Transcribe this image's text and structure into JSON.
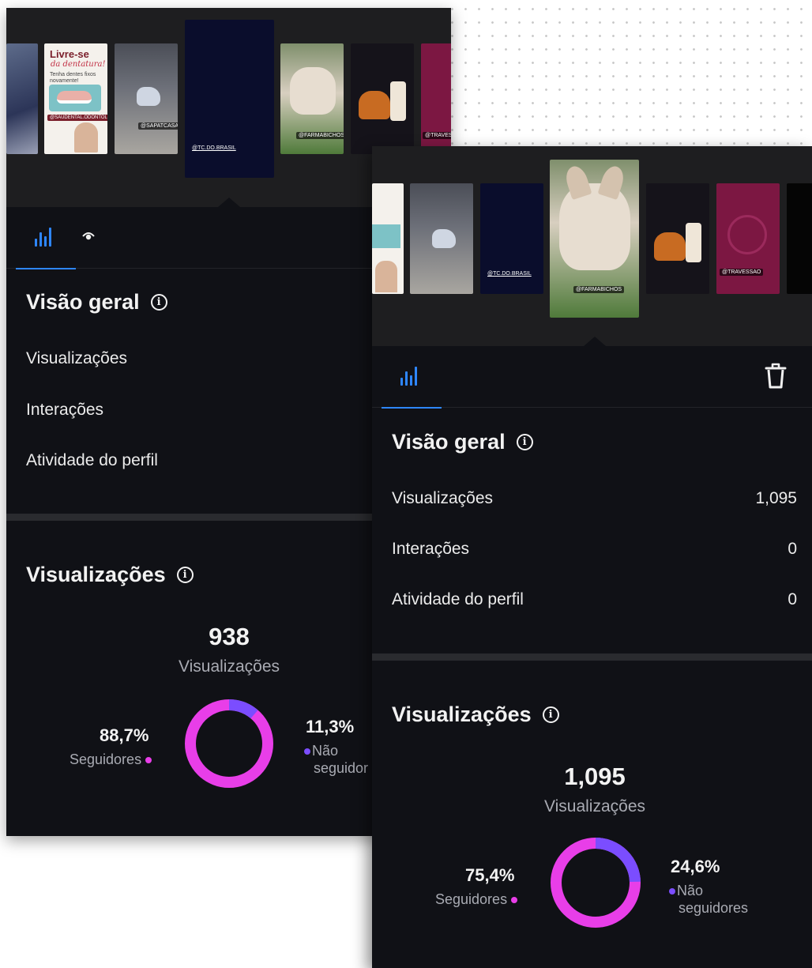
{
  "colors": {
    "panel_bg": "#101116",
    "accent_blue": "#2e86ff",
    "followers": "#e83ee8",
    "non_followers": "#7b4dff"
  },
  "left": {
    "story_tags": [
      "@SAUDENTAL.ODONTOLOGIA",
      "@SAPATCASAO",
      "@TC.DO.BRASIL",
      "@FARMABICHOS",
      "@TRAVESSAO"
    ],
    "story_texts": {
      "dental_title": "Livre-se",
      "dental_script": "da dentatura!",
      "dental_sub": "Tenha dentes fixos novamente!"
    },
    "tabs": [
      {
        "icon": "bar-chart-icon"
      },
      {
        "icon": "eye-icon"
      }
    ],
    "overview_title": "Visão geral",
    "metrics": [
      {
        "label": "Visualizações"
      },
      {
        "label": "Interações"
      },
      {
        "label": "Atividade do perfil"
      }
    ],
    "views_title": "Visualizações",
    "views_total": "938",
    "views_total_label": "Visualizações",
    "followers_pct": "88,7%",
    "followers_label": "Seguidores",
    "followers_share": 0.887,
    "non_followers_pct": "11,3%",
    "non_followers_label_1": "Não",
    "non_followers_label_2": "seguidor"
  },
  "right": {
    "story_tags": [
      "@TC.DO.BRASIL",
      "@FARMABICHOS",
      "@TRAVESSAO"
    ],
    "tabs": [
      {
        "icon": "bar-chart-icon"
      },
      {
        "icon": "trash-icon"
      }
    ],
    "overview_title": "Visão geral",
    "metrics": [
      {
        "label": "Visualizações",
        "value": "1,095"
      },
      {
        "label": "Interações",
        "value": "0"
      },
      {
        "label": "Atividade do perfil",
        "value": "0"
      }
    ],
    "views_title": "Visualizações",
    "views_total": "1,095",
    "views_total_label": "Visualizações",
    "followers_pct": "75,4%",
    "followers_label": "Seguidores",
    "followers_share": 0.754,
    "non_followers_pct": "24,6%",
    "non_followers_label_1": "Não",
    "non_followers_label_2": "seguidores"
  }
}
